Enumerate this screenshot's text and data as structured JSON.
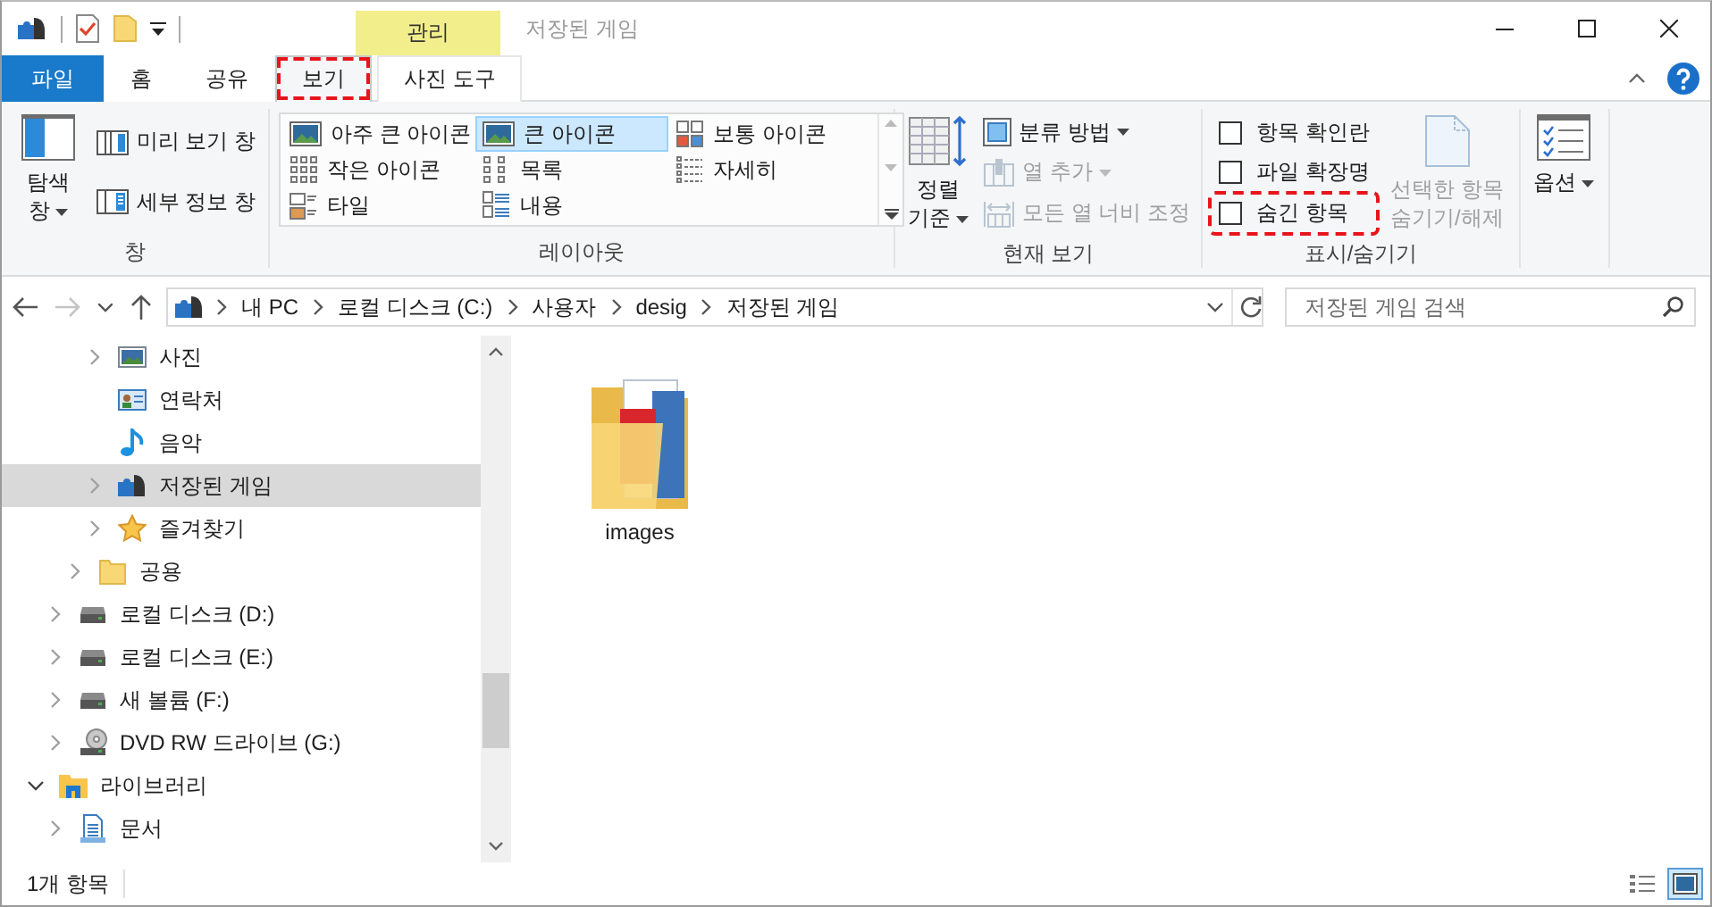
{
  "title_bar": {
    "context_header": "관리",
    "title": "저장된 게임"
  },
  "tabs": [
    {
      "label": "파일",
      "kind": "file",
      "selected": false,
      "highlighted": false
    },
    {
      "label": "홈",
      "kind": "normal",
      "selected": false,
      "highlighted": false
    },
    {
      "label": "공유",
      "kind": "normal",
      "selected": false,
      "highlighted": false
    },
    {
      "label": "보기",
      "kind": "normal",
      "selected": true,
      "highlighted": true
    },
    {
      "label": "사진 도구",
      "kind": "context",
      "selected": false,
      "highlighted": false
    }
  ],
  "ribbon": {
    "groups": [
      {
        "kind": "panes",
        "label": "창",
        "big_button": {
          "label": "탐색 창",
          "dropdown": true,
          "disabled": false
        },
        "buttons": [
          {
            "label": "미리 보기 창",
            "dropdown": false,
            "disabled": false
          },
          {
            "label": "세부 정보 창",
            "dropdown": false,
            "disabled": false
          }
        ]
      },
      {
        "kind": "layout",
        "label": "레이아웃",
        "items": [
          {
            "label": "아주 큰 아이콘",
            "selected": false
          },
          {
            "label": "큰 아이콘",
            "selected": true
          },
          {
            "label": "보통 아이콘",
            "selected": false
          },
          {
            "label": "작은 아이콘",
            "selected": false
          },
          {
            "label": "목록",
            "selected": false
          },
          {
            "label": "자세히",
            "selected": false
          },
          {
            "label": "타일",
            "selected": false
          },
          {
            "label": "내용",
            "selected": false
          }
        ]
      },
      {
        "kind": "current_view",
        "label": "현재 보기",
        "big_button": {
          "label": "정렬 기준",
          "dropdown": true,
          "disabled": false
        },
        "buttons": [
          {
            "label": "분류 방법",
            "dropdown": true,
            "disabled": false
          },
          {
            "label": "열 추가",
            "dropdown": true,
            "disabled": true
          },
          {
            "label": "모든 열 너비 조정",
            "dropdown": false,
            "disabled": true
          }
        ]
      },
      {
        "kind": "show_hide",
        "label": "표시/숨기기",
        "checkboxes": [
          {
            "label": "항목 확인란",
            "checked": false,
            "highlighted": false
          },
          {
            "label": "파일 확장명",
            "checked": false,
            "highlighted": false
          },
          {
            "label": "숨긴 항목",
            "checked": false,
            "highlighted": true
          }
        ],
        "big_button": {
          "label": "선택한 항목 숨기기/해제",
          "dropdown": false,
          "disabled": true
        }
      },
      {
        "kind": "options",
        "big_button": {
          "label": "옵션",
          "dropdown": true,
          "disabled": false
        }
      }
    ]
  },
  "address_bar": {
    "nav_buttons": [
      {
        "kind": "back",
        "disabled": false
      },
      {
        "kind": "forward",
        "disabled": true
      },
      {
        "kind": "recent",
        "disabled": false
      },
      {
        "kind": "up",
        "disabled": false
      }
    ],
    "crumbs": [
      "내 PC",
      "로컬 디스크 (C:)",
      "사용자",
      "desig",
      "저장된 게임"
    ],
    "search": {
      "placeholder": "저장된 게임 검색"
    }
  },
  "nav_tree": [
    {
      "children": [
        {
          "children": [
            {
              "children": [
                {
                  "label": "사진",
                  "kind": "picture",
                  "expandable": true,
                  "expanded": false,
                  "selected": false
                },
                {
                  "label": "연락처",
                  "kind": "contact",
                  "expandable": false,
                  "selected": false
                },
                {
                  "label": "음악",
                  "kind": "music",
                  "expandable": false,
                  "selected": false
                },
                {
                  "label": "저장된 게임",
                  "kind": "games",
                  "expandable": true,
                  "expanded": false,
                  "selected": true
                },
                {
                  "label": "즐겨찾기",
                  "kind": "star",
                  "expandable": true,
                  "expanded": false,
                  "selected": false
                }
              ]
            },
            {
              "label": "공용",
              "kind": "folder",
              "expandable": true,
              "expanded": false,
              "selected": false
            }
          ]
        },
        {
          "label": "로컬 디스크 (D:)",
          "kind": "drive",
          "expandable": true,
          "expanded": false,
          "selected": false
        },
        {
          "label": "로컬 디스크 (E:)",
          "kind": "drive",
          "expandable": true,
          "expanded": false,
          "selected": false
        },
        {
          "label": "새 볼륨 (F:)",
          "kind": "drive",
          "expandable": true,
          "expanded": false,
          "selected": false
        },
        {
          "label": "DVD RW 드라이브 (G:)",
          "kind": "dvd",
          "expandable": true,
          "expanded": false,
          "selected": false
        }
      ]
    },
    {
      "label": "라이브러리",
      "kind": "library",
      "expandable": true,
      "expanded": true,
      "selected": false,
      "children": [
        {
          "label": "문서",
          "kind": "document",
          "expandable": true,
          "expanded": false,
          "selected": false
        }
      ]
    }
  ],
  "files": [
    {
      "name": "images",
      "kind": "folder",
      "selected": false
    }
  ],
  "status_bar": {
    "item_count": "1개 항목",
    "views": [
      {
        "kind": "details",
        "selected": false
      },
      {
        "kind": "large_icons",
        "selected": true
      }
    ]
  }
}
